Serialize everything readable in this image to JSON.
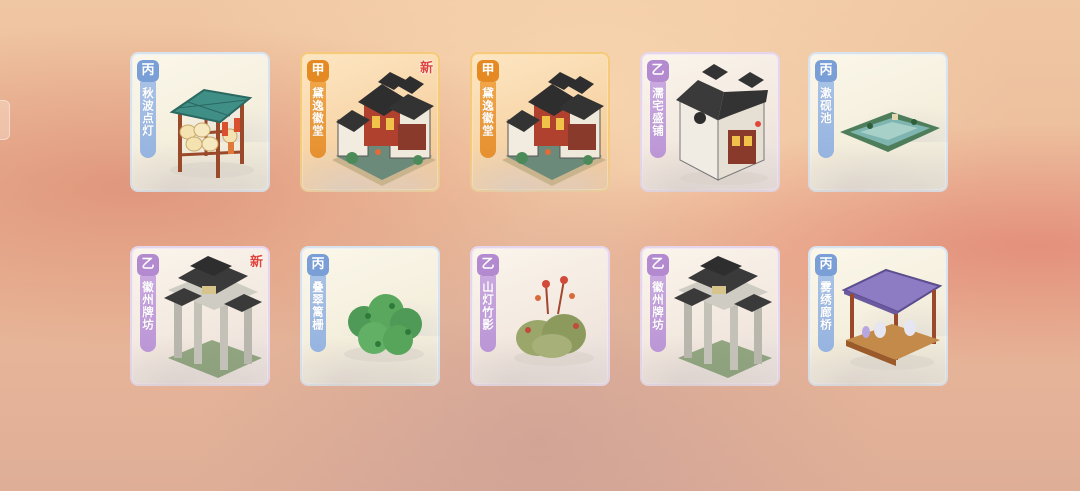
{
  "cards": [
    {
      "grade": "丙",
      "name": "秋波点灯",
      "rarity": "bing",
      "is_new": false,
      "new_label": "",
      "icon": "lantern-pavilion-icon"
    },
    {
      "grade": "甲",
      "name": "黛逸徽堂",
      "rarity": "jia",
      "is_new": true,
      "new_label": "新",
      "icon": "hui-mansion-icon"
    },
    {
      "grade": "甲",
      "name": "黛逸徽堂",
      "rarity": "jia",
      "is_new": false,
      "new_label": "",
      "icon": "hui-mansion-icon"
    },
    {
      "grade": "乙",
      "name": "濡宅盛铺",
      "rarity": "yi",
      "is_new": false,
      "new_label": "",
      "icon": "white-wall-shop-icon"
    },
    {
      "grade": "丙",
      "name": "漱砚池",
      "rarity": "bing",
      "is_new": false,
      "new_label": "",
      "icon": "ink-pond-icon"
    },
    {
      "grade": "乙",
      "name": "徽州牌坊",
      "rarity": "yi",
      "is_new": true,
      "new_label": "新",
      "icon": "memorial-archway-icon"
    },
    {
      "grade": "丙",
      "name": "叠翠篱栅",
      "rarity": "bing",
      "is_new": false,
      "new_label": "",
      "icon": "green-hedge-icon"
    },
    {
      "grade": "乙",
      "name": "山灯竹影",
      "rarity": "yi",
      "is_new": false,
      "new_label": "",
      "icon": "rock-bamboo-icon"
    },
    {
      "grade": "乙",
      "name": "徽州牌坊",
      "rarity": "yi",
      "is_new": false,
      "new_label": "",
      "icon": "memorial-archway-icon"
    },
    {
      "grade": "丙",
      "name": "雾绣廊桥",
      "rarity": "bing",
      "is_new": false,
      "new_label": "",
      "icon": "purple-pavilion-icon"
    }
  ],
  "colors": {
    "grade_bing": "#7a9fd6",
    "grade_yi": "#b38ad0",
    "grade_jia": "#e58a22",
    "new_badge": "#e0443a"
  }
}
